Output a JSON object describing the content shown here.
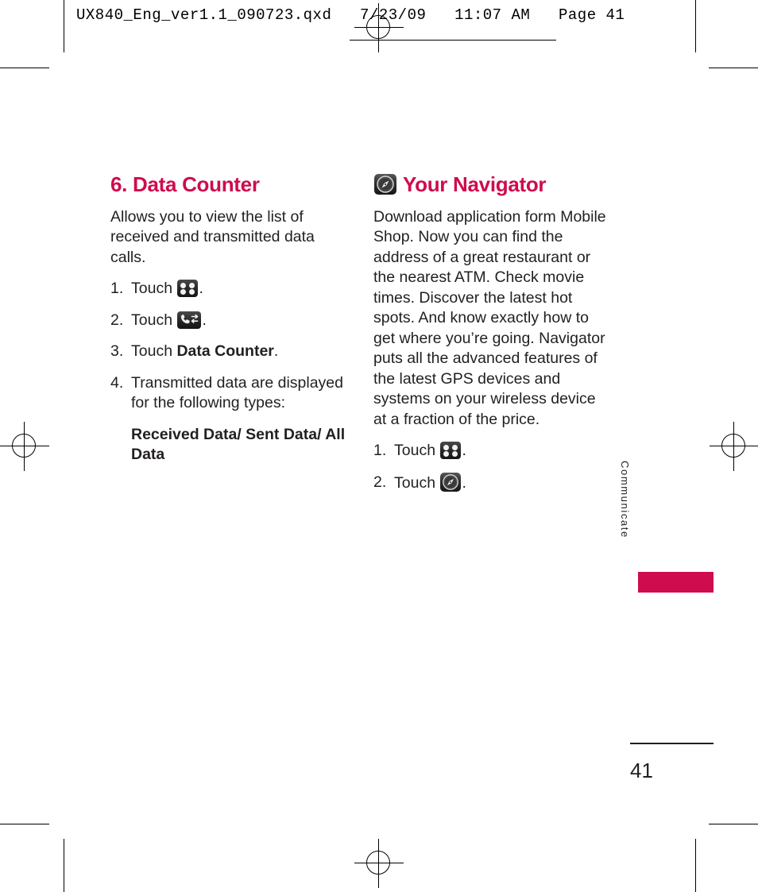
{
  "print_header": "UX840_Eng_ver1.1_090723.qxd   7/23/09   11:07 AM   Page 41",
  "left_column": {
    "heading": "6. Data Counter",
    "intro": "Allows you to view the list of received and transmitted data calls.",
    "steps": [
      {
        "num": "1.",
        "pre": "Touch ",
        "icon": "grid-icon",
        "post": "."
      },
      {
        "num": "2.",
        "pre": "Touch ",
        "icon": "calls-icon",
        "post": "."
      },
      {
        "num": "3.",
        "pre": "Touch ",
        "bold": "Data Counter",
        "post": "."
      },
      {
        "num": "4.",
        "pre": "Transmitted data are displayed for the following types:",
        "post": ""
      }
    ],
    "sub_note": "Received Data/ Sent Data/ All Data"
  },
  "right_column": {
    "heading_icon": "compass-icon",
    "heading": "Your Navigator",
    "body": "Download application form Mobile Shop. Now you can find the address of a great restaurant or the nearest ATM. Check movie times. Discover the latest hot spots. And know exactly how to get where you’re going. Navigator puts all the advanced features of the latest GPS devices and systems on your wireless device at a fraction of the price.",
    "steps": [
      {
        "num": "1.",
        "pre": "Touch ",
        "icon": "grid-icon",
        "post": "."
      },
      {
        "num": "2.",
        "pre": "Touch ",
        "icon": "compass-icon",
        "post": "."
      }
    ]
  },
  "side_tab": {
    "label": "Communicate",
    "color": "#ce0c4e"
  },
  "footer": {
    "page_number": "41"
  },
  "colors": {
    "heading": "#ce0c4e",
    "text": "#231f20"
  }
}
